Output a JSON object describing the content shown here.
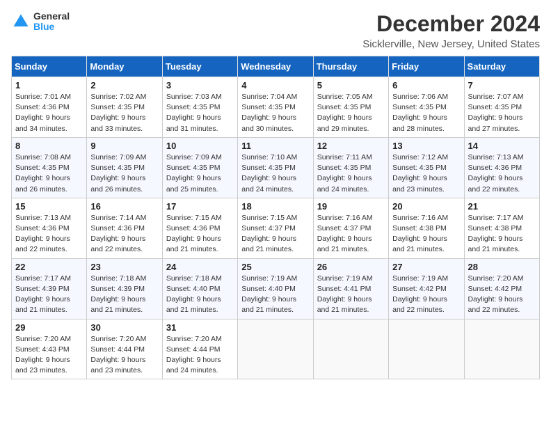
{
  "logo": {
    "general": "General",
    "blue": "Blue"
  },
  "title": "December 2024",
  "subtitle": "Sicklerville, New Jersey, United States",
  "headers": [
    "Sunday",
    "Monday",
    "Tuesday",
    "Wednesday",
    "Thursday",
    "Friday",
    "Saturday"
  ],
  "weeks": [
    [
      {
        "day": 1,
        "sunrise": "7:01 AM",
        "sunset": "4:36 PM",
        "daylight": "9 hours and 34 minutes."
      },
      {
        "day": 2,
        "sunrise": "7:02 AM",
        "sunset": "4:35 PM",
        "daylight": "9 hours and 33 minutes."
      },
      {
        "day": 3,
        "sunrise": "7:03 AM",
        "sunset": "4:35 PM",
        "daylight": "9 hours and 31 minutes."
      },
      {
        "day": 4,
        "sunrise": "7:04 AM",
        "sunset": "4:35 PM",
        "daylight": "9 hours and 30 minutes."
      },
      {
        "day": 5,
        "sunrise": "7:05 AM",
        "sunset": "4:35 PM",
        "daylight": "9 hours and 29 minutes."
      },
      {
        "day": 6,
        "sunrise": "7:06 AM",
        "sunset": "4:35 PM",
        "daylight": "9 hours and 28 minutes."
      },
      {
        "day": 7,
        "sunrise": "7:07 AM",
        "sunset": "4:35 PM",
        "daylight": "9 hours and 27 minutes."
      }
    ],
    [
      {
        "day": 8,
        "sunrise": "7:08 AM",
        "sunset": "4:35 PM",
        "daylight": "9 hours and 26 minutes."
      },
      {
        "day": 9,
        "sunrise": "7:09 AM",
        "sunset": "4:35 PM",
        "daylight": "9 hours and 26 minutes."
      },
      {
        "day": 10,
        "sunrise": "7:09 AM",
        "sunset": "4:35 PM",
        "daylight": "9 hours and 25 minutes."
      },
      {
        "day": 11,
        "sunrise": "7:10 AM",
        "sunset": "4:35 PM",
        "daylight": "9 hours and 24 minutes."
      },
      {
        "day": 12,
        "sunrise": "7:11 AM",
        "sunset": "4:35 PM",
        "daylight": "9 hours and 24 minutes."
      },
      {
        "day": 13,
        "sunrise": "7:12 AM",
        "sunset": "4:35 PM",
        "daylight": "9 hours and 23 minutes."
      },
      {
        "day": 14,
        "sunrise": "7:13 AM",
        "sunset": "4:36 PM",
        "daylight": "9 hours and 22 minutes."
      }
    ],
    [
      {
        "day": 15,
        "sunrise": "7:13 AM",
        "sunset": "4:36 PM",
        "daylight": "9 hours and 22 minutes."
      },
      {
        "day": 16,
        "sunrise": "7:14 AM",
        "sunset": "4:36 PM",
        "daylight": "9 hours and 22 minutes."
      },
      {
        "day": 17,
        "sunrise": "7:15 AM",
        "sunset": "4:36 PM",
        "daylight": "9 hours and 21 minutes."
      },
      {
        "day": 18,
        "sunrise": "7:15 AM",
        "sunset": "4:37 PM",
        "daylight": "9 hours and 21 minutes."
      },
      {
        "day": 19,
        "sunrise": "7:16 AM",
        "sunset": "4:37 PM",
        "daylight": "9 hours and 21 minutes."
      },
      {
        "day": 20,
        "sunrise": "7:16 AM",
        "sunset": "4:38 PM",
        "daylight": "9 hours and 21 minutes."
      },
      {
        "day": 21,
        "sunrise": "7:17 AM",
        "sunset": "4:38 PM",
        "daylight": "9 hours and 21 minutes."
      }
    ],
    [
      {
        "day": 22,
        "sunrise": "7:17 AM",
        "sunset": "4:39 PM",
        "daylight": "9 hours and 21 minutes."
      },
      {
        "day": 23,
        "sunrise": "7:18 AM",
        "sunset": "4:39 PM",
        "daylight": "9 hours and 21 minutes."
      },
      {
        "day": 24,
        "sunrise": "7:18 AM",
        "sunset": "4:40 PM",
        "daylight": "9 hours and 21 minutes."
      },
      {
        "day": 25,
        "sunrise": "7:19 AM",
        "sunset": "4:40 PM",
        "daylight": "9 hours and 21 minutes."
      },
      {
        "day": 26,
        "sunrise": "7:19 AM",
        "sunset": "4:41 PM",
        "daylight": "9 hours and 21 minutes."
      },
      {
        "day": 27,
        "sunrise": "7:19 AM",
        "sunset": "4:42 PM",
        "daylight": "9 hours and 22 minutes."
      },
      {
        "day": 28,
        "sunrise": "7:20 AM",
        "sunset": "4:42 PM",
        "daylight": "9 hours and 22 minutes."
      }
    ],
    [
      {
        "day": 29,
        "sunrise": "7:20 AM",
        "sunset": "4:43 PM",
        "daylight": "9 hours and 23 minutes."
      },
      {
        "day": 30,
        "sunrise": "7:20 AM",
        "sunset": "4:44 PM",
        "daylight": "9 hours and 23 minutes."
      },
      {
        "day": 31,
        "sunrise": "7:20 AM",
        "sunset": "4:44 PM",
        "daylight": "9 hours and 24 minutes."
      },
      null,
      null,
      null,
      null
    ]
  ]
}
